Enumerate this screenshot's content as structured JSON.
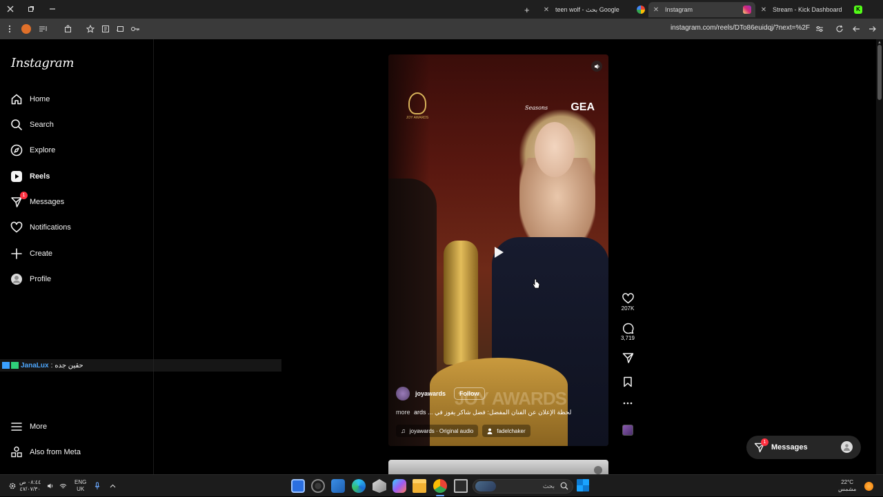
{
  "browser": {
    "tabs": [
      {
        "title": "teen wolf - بحث Google",
        "active": false
      },
      {
        "title": "Instagram",
        "active": true
      },
      {
        "title": "Stream - Kick Dashboard",
        "active": false
      }
    ],
    "new_tab_symbol": "+",
    "url": "instagram.com/reels/DTo86euidqj/?next=%2F"
  },
  "sidebar": {
    "logo": "Instagram",
    "items": [
      {
        "label": "Home",
        "icon": "home-icon"
      },
      {
        "label": "Search",
        "icon": "search-icon"
      },
      {
        "label": "Explore",
        "icon": "compass-icon"
      },
      {
        "label": "Reels",
        "icon": "reels-icon"
      },
      {
        "label": "Messages",
        "icon": "messenger-icon",
        "badge": "1"
      },
      {
        "label": "Notifications",
        "icon": "heart-icon"
      },
      {
        "label": "Create",
        "icon": "plus-icon"
      },
      {
        "label": "Profile",
        "icon": "avatar-icon"
      }
    ],
    "bottom": [
      {
        "label": "More",
        "icon": "menu-icon"
      },
      {
        "label": "Also from Meta",
        "icon": "meta-apps-icon"
      }
    ]
  },
  "stream_overlay": {
    "username": "JanaLux",
    "separator": " : ",
    "message": "حقين جده"
  },
  "reel": {
    "logo_left": "JOY AWARDS",
    "logo_right_main": "GEA",
    "logo_right_script": "Seasons",
    "username": "joyawards",
    "follow_label": "Follow",
    "watermark": "JOY AWARDS",
    "caption": "لحظة الإعلان عن الفنان المفضل: فضل شاكر يفوز في ... ards",
    "more_label": "more",
    "audio": "joyawards · Original audio",
    "tagged_user": "fadelchaker",
    "likes": "207K",
    "comments": "3,719"
  },
  "messages_bubble": {
    "label": "Messages",
    "badge": "1"
  },
  "taskbar": {
    "time": "٠٨:٤٤ ص",
    "date": "٤٧/٠٧/٣٠",
    "lang_top": "ENG",
    "lang_bottom": "UK",
    "search_placeholder": "بحث",
    "weather_temp": "22°C",
    "weather_desc": "مشمس"
  },
  "colors": {
    "accent_badge": "#ff3040",
    "overlay_name": "#4ea8ff",
    "background": "#000000"
  }
}
